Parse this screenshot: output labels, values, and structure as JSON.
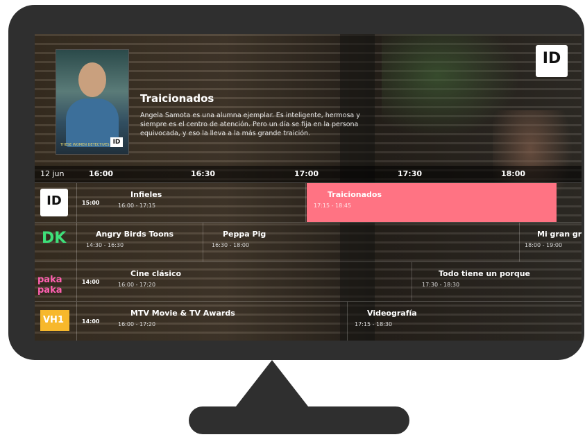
{
  "program": {
    "title": "Traicionados",
    "description": "Angela Samota es una alumna ejemplar. Es inteligente, hermosa y siempre es el centro de atención. Pero un día se fija en la persona equivocada, y eso la lleva a la más grande traición.",
    "poster_tagline": "THESE WOMEN DETECTIVES",
    "poster_badge": "ID"
  },
  "corner_logo": "ID",
  "timebar": {
    "date": "12 jun",
    "ticks": [
      "16:00",
      "16:30",
      "17:00",
      "17:30",
      "18:00"
    ]
  },
  "channels": [
    {
      "logo": "ID",
      "start_time": "15:00",
      "programs": [
        {
          "title": "Infieles",
          "range": "16:00 - 17:15"
        },
        {
          "title": "Traicionados",
          "range": "17:15 - 18:45"
        }
      ]
    },
    {
      "logo": "DK",
      "start_time": "",
      "programs": [
        {
          "title": "Angry Birds Toons",
          "range": "14:30 - 16:30"
        },
        {
          "title": "Peppa Pig",
          "range": "16:30 - 18:00"
        },
        {
          "title": "Mi gran gr",
          "range": "18:00 - 19:00"
        }
      ]
    },
    {
      "logo": "paka paka",
      "start_time": "14:00",
      "programs": [
        {
          "title": "Cine clásico",
          "range": "16:00 - 17:20"
        },
        {
          "title": "Todo tiene un porque",
          "range": "17:30 - 18:30"
        }
      ]
    },
    {
      "logo": "VH1",
      "start_time": "14:00",
      "programs": [
        {
          "title": "MTV Movie & TV Awards",
          "range": "16:00 - 17:20"
        },
        {
          "title": "Videografía",
          "range": "17:15 - 18:30"
        }
      ]
    }
  ]
}
